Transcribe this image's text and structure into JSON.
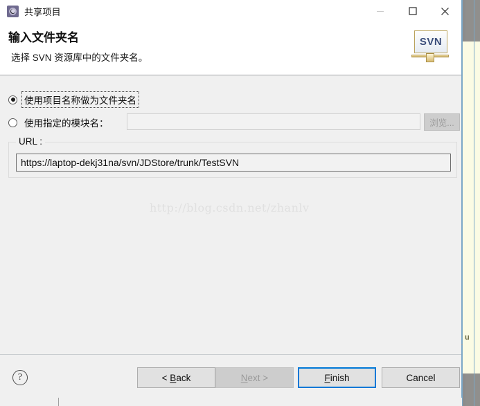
{
  "window": {
    "title": "共享项目",
    "app_icon": "gear-icon",
    "controls": {
      "minimize": "minimize-icon",
      "maximize": "maximize-icon",
      "close": "close-icon"
    }
  },
  "header": {
    "title": "输入文件夹名",
    "subtitle": "选择 SVN 资源库中的文件夹名。",
    "logo_text": "SVN"
  },
  "form": {
    "radio_use_project_name": {
      "label": "使用项目名称做为文件夹名",
      "selected": true,
      "focused": true
    },
    "radio_use_module_name": {
      "label": "使用指定的模块名：",
      "selected": false
    },
    "module_input": {
      "value": "",
      "placeholder": "",
      "enabled": false
    },
    "browse_button": {
      "label": "浏览...",
      "enabled": false
    },
    "url_group": {
      "label": "URL :",
      "value": "https://laptop-dekj31na/svn/JDStore/trunk/TestSVN"
    }
  },
  "watermark": {
    "text": "http://blog.csdn.net/zhanlv"
  },
  "footer": {
    "help": "?",
    "back": "< Back",
    "back_mnemonic": "B",
    "next": "Next >",
    "next_mnemonic": "N",
    "finish": "Finish",
    "finish_mnemonic": "F",
    "cancel": "Cancel"
  },
  "background": {
    "side_letter": "u"
  },
  "colors": {
    "dialog_bg": "#f0f0f0",
    "header_bg": "#ffffff",
    "focus_blue": "#0078d7",
    "disabled_text": "#9a9a9a",
    "edge_blue": "#7ba7c7",
    "side_gray": "#908f8d",
    "strip_yellow": "#fbfbe4"
  }
}
